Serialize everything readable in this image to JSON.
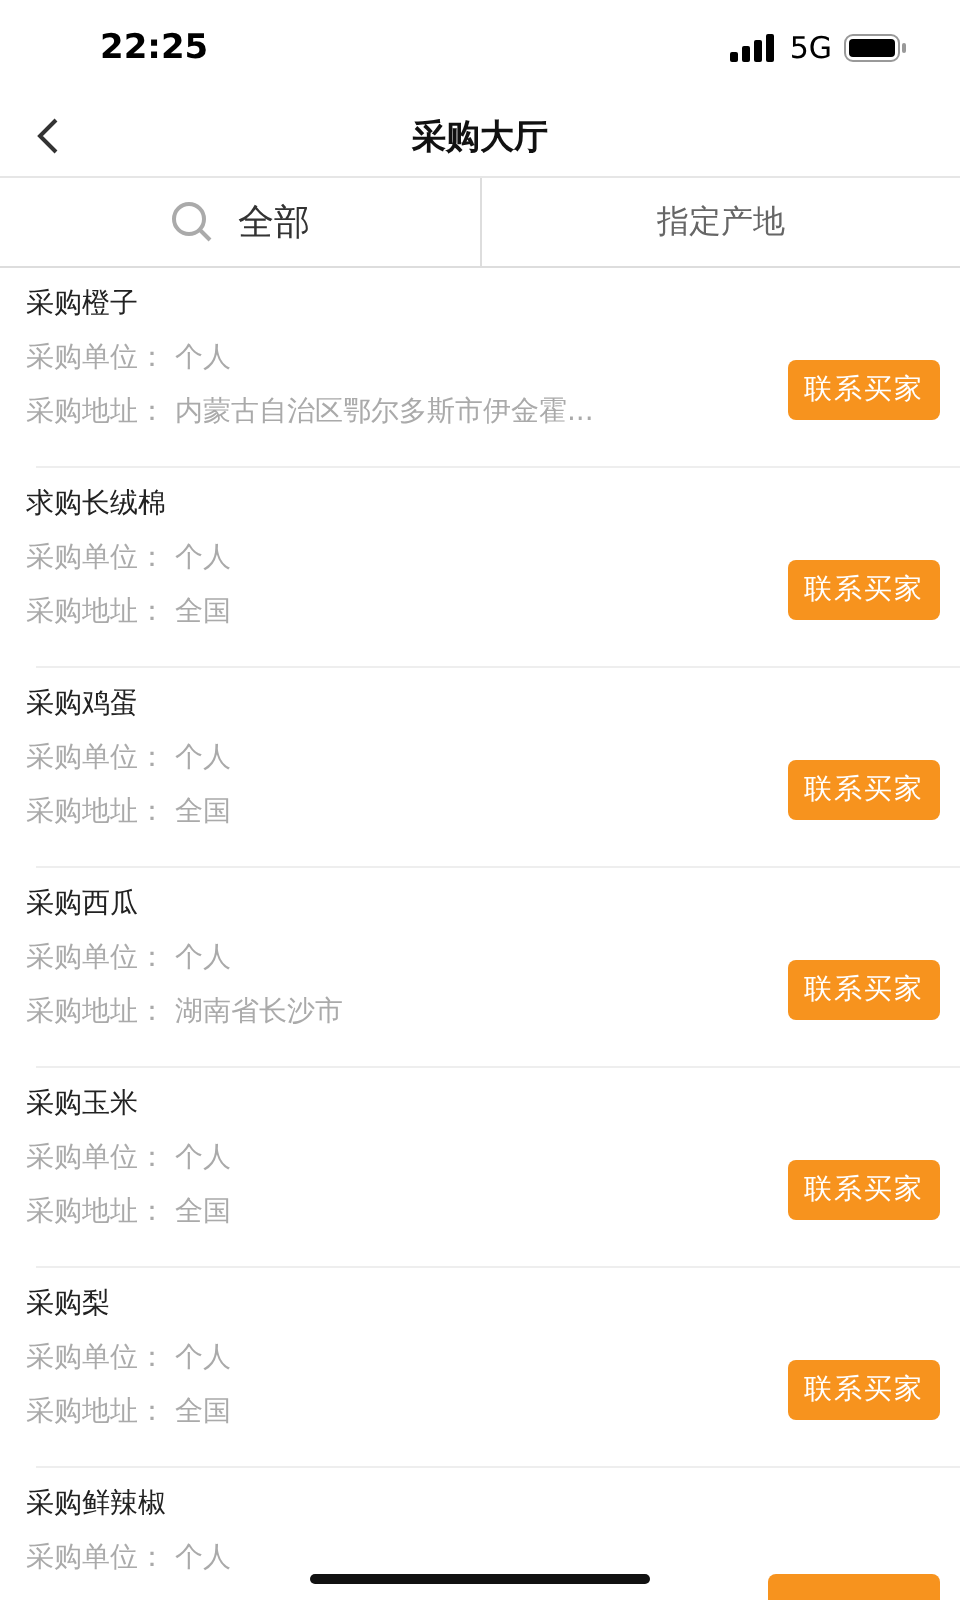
{
  "status_bar": {
    "time": "22:25",
    "network": "5G"
  },
  "nav": {
    "title": "采购大厅"
  },
  "tabs": [
    {
      "label": "全部",
      "selected": true,
      "kind": "search"
    },
    {
      "label": "指定产地",
      "selected": false,
      "kind": "plain"
    }
  ],
  "items": [
    {
      "title": "采购橙子",
      "unit_label": "采购单位：",
      "unit": "个人",
      "address_label": "采购地址：",
      "address": "内蒙古自治区鄂尔多斯市伊金霍...",
      "button": "联系买家"
    },
    {
      "title": "求购长绒棉",
      "unit_label": "采购单位：",
      "unit": "个人",
      "address_label": "采购地址：",
      "address": "全国",
      "button": "联系买家"
    },
    {
      "title": "采购鸡蛋",
      "unit_label": "采购单位：",
      "unit": "个人",
      "address_label": "采购地址：",
      "address": "全国",
      "button": "联系买家"
    },
    {
      "title": "采购西瓜",
      "unit_label": "采购单位：",
      "unit": "个人",
      "address_label": "采购地址：",
      "address": "湖南省长沙市",
      "button": "联系买家"
    },
    {
      "title": "采购玉米",
      "unit_label": "采购单位：",
      "unit": "个人",
      "address_label": "采购地址：",
      "address": "全国",
      "button": "联系买家"
    },
    {
      "title": "采购梨",
      "unit_label": "采购单位：",
      "unit": "个人",
      "address_label": "采购地址：",
      "address": "全国",
      "button": "联系买家"
    },
    {
      "title": "采购鲜辣椒",
      "unit_label": "采购单位：",
      "unit": "个人"
    }
  ]
}
